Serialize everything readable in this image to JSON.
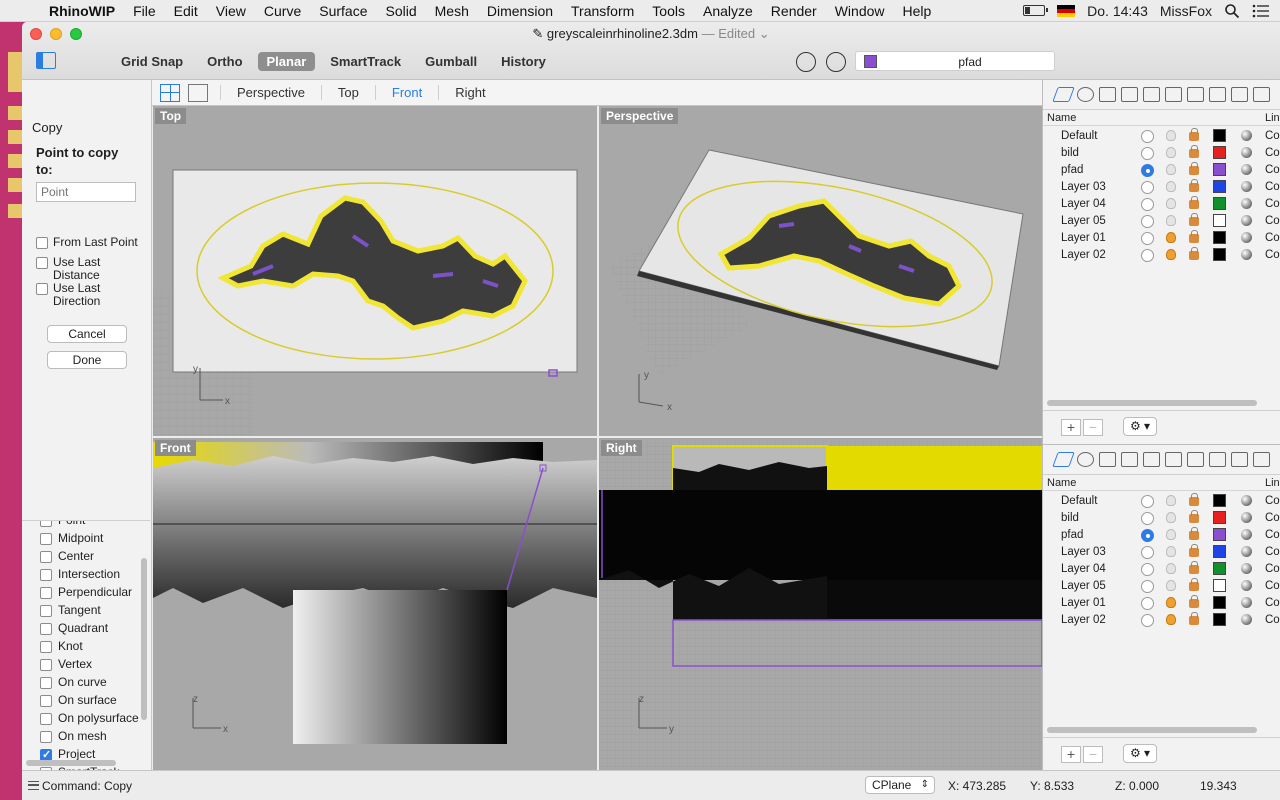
{
  "menubar": {
    "app": "RhinoWIP",
    "items": [
      "File",
      "Edit",
      "View",
      "Curve",
      "Surface",
      "Solid",
      "Mesh",
      "Dimension",
      "Transform",
      "Tools",
      "Analyze",
      "Render",
      "Window",
      "Help"
    ],
    "clock": "Do. 14:43",
    "user": "MissFox"
  },
  "window": {
    "title": "greyscaleinrhinoline2.3dm",
    "edited": "— Edited"
  },
  "modes": [
    "Grid Snap",
    "Ortho",
    "Planar",
    "SmartTrack",
    "Gumball",
    "History"
  ],
  "active_mode": "Planar",
  "current_layer": {
    "name": "pfad",
    "color": "#8a4fd0"
  },
  "command_panel": {
    "title": "Copy",
    "prompt": "Point to copy to:",
    "input_placeholder": "Point",
    "options": [
      {
        "label": "From Last Point",
        "checked": false
      },
      {
        "label": "Use Last Distance",
        "checked": false
      },
      {
        "label": "Use Last Direction",
        "checked": false
      }
    ],
    "cancel_label": "Cancel",
    "done_label": "Done"
  },
  "osnaps": [
    {
      "label": "Point",
      "checked": false
    },
    {
      "label": "Midpoint",
      "checked": false
    },
    {
      "label": "Center",
      "checked": false
    },
    {
      "label": "Intersection",
      "checked": false
    },
    {
      "label": "Perpendicular",
      "checked": false
    },
    {
      "label": "Tangent",
      "checked": false
    },
    {
      "label": "Quadrant",
      "checked": false
    },
    {
      "label": "Knot",
      "checked": false
    },
    {
      "label": "Vertex",
      "checked": false
    },
    {
      "label": "On curve",
      "checked": false
    },
    {
      "label": "On surface",
      "checked": false
    },
    {
      "label": "On polysurface",
      "checked": false
    },
    {
      "label": "On mesh",
      "checked": false
    },
    {
      "label": "Project",
      "checked": true
    },
    {
      "label": "SmartTrack",
      "checked": false
    }
  ],
  "viewport_tabs": [
    "Perspective",
    "Top",
    "Front",
    "Right"
  ],
  "active_viewport_tab": "Front",
  "viewports": {
    "top": "Top",
    "perspective": "Perspective",
    "front": "Front",
    "right": "Right"
  },
  "layers_panel": {
    "col_name": "Name",
    "col_linetype": "Lin",
    "linetype_value": "Co",
    "layers": [
      {
        "name": "Default",
        "current": false,
        "on": false,
        "color": "#000000"
      },
      {
        "name": "bild",
        "current": false,
        "on": false,
        "color": "#e62020"
      },
      {
        "name": "pfad",
        "current": true,
        "on": false,
        "color": "#8a4fd0"
      },
      {
        "name": "Layer 03",
        "current": false,
        "on": false,
        "color": "#1e44e6"
      },
      {
        "name": "Layer 04",
        "current": false,
        "on": false,
        "color": "#10922b"
      },
      {
        "name": "Layer 05",
        "current": false,
        "on": false,
        "color": "#ffffff"
      },
      {
        "name": "Layer 01",
        "current": false,
        "on": true,
        "color": "#000000"
      },
      {
        "name": "Layer 02",
        "current": false,
        "on": true,
        "color": "#000000"
      }
    ],
    "add_label": "+",
    "remove_label": "−",
    "gear_label": "⚙ ▾"
  },
  "statusbar": {
    "command": "Command: Copy",
    "cplane": "CPlane",
    "x": "X: 473.285",
    "y": "Y: 8.533",
    "z": "Z: 0.000",
    "distance": "19.343"
  }
}
